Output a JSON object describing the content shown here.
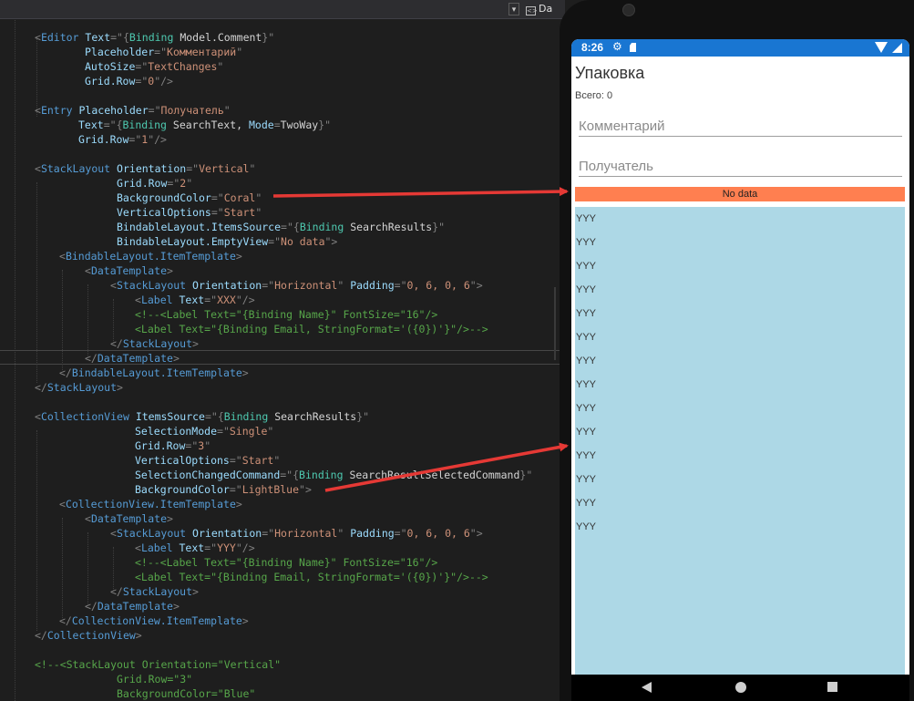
{
  "editor": {
    "tab_label": "Da",
    "dropdown_glyph": "▾",
    "tab_icon_glyph": "<>",
    "lines": [
      {
        "indent": 38,
        "tokens": [
          [
            "t-punc",
            "<"
          ],
          [
            "t-tag",
            "Editor"
          ],
          [
            "t-text",
            " "
          ],
          [
            "t-attr",
            "Text"
          ],
          [
            "t-punc",
            "=\""
          ],
          [
            "t-punc",
            "{"
          ],
          [
            "t-bkw",
            "Binding"
          ],
          [
            "t-text",
            " "
          ],
          [
            "t-bind",
            "Model.Comment"
          ],
          [
            "t-punc",
            "}\""
          ]
        ]
      },
      {
        "indent": 93,
        "tokens": [
          [
            "t-attr",
            "Placeholder"
          ],
          [
            "t-punc",
            "=\""
          ],
          [
            "t-val",
            "Комментарий"
          ],
          [
            "t-punc",
            "\""
          ]
        ]
      },
      {
        "indent": 93,
        "tokens": [
          [
            "t-attr",
            "AutoSize"
          ],
          [
            "t-punc",
            "=\""
          ],
          [
            "t-val",
            "TextChanges"
          ],
          [
            "t-punc",
            "\""
          ]
        ]
      },
      {
        "indent": 93,
        "tokens": [
          [
            "t-attr",
            "Grid.Row"
          ],
          [
            "t-punc",
            "=\""
          ],
          [
            "t-val",
            "0"
          ],
          [
            "t-punc",
            "\"/>"
          ]
        ]
      },
      {
        "indent": 0,
        "tokens": []
      },
      {
        "indent": 38,
        "tokens": [
          [
            "t-punc",
            "<"
          ],
          [
            "t-tag",
            "Entry"
          ],
          [
            "t-text",
            " "
          ],
          [
            "t-attr",
            "Placeholder"
          ],
          [
            "t-punc",
            "=\""
          ],
          [
            "t-val",
            "Получатель"
          ],
          [
            "t-punc",
            "\""
          ]
        ]
      },
      {
        "indent": 86,
        "tokens": [
          [
            "t-attr",
            "Text"
          ],
          [
            "t-punc",
            "=\""
          ],
          [
            "t-punc",
            "{"
          ],
          [
            "t-bkw",
            "Binding"
          ],
          [
            "t-text",
            " "
          ],
          [
            "t-bind",
            "SearchText, "
          ],
          [
            "t-attr",
            "Mode"
          ],
          [
            "t-punc",
            "="
          ],
          [
            "t-bind",
            "TwoWay"
          ],
          [
            "t-punc",
            "}\""
          ]
        ]
      },
      {
        "indent": 86,
        "tokens": [
          [
            "t-attr",
            "Grid.Row"
          ],
          [
            "t-punc",
            "=\""
          ],
          [
            "t-val",
            "1"
          ],
          [
            "t-punc",
            "\"/>"
          ]
        ]
      },
      {
        "indent": 0,
        "tokens": []
      },
      {
        "indent": 38,
        "tokens": [
          [
            "t-punc",
            "<"
          ],
          [
            "t-tag",
            "StackLayout"
          ],
          [
            "t-text",
            " "
          ],
          [
            "t-attr",
            "Orientation"
          ],
          [
            "t-punc",
            "=\""
          ],
          [
            "t-val",
            "Vertical"
          ],
          [
            "t-punc",
            "\""
          ]
        ]
      },
      {
        "indent": 128,
        "tokens": [
          [
            "t-attr",
            "Grid.Row"
          ],
          [
            "t-punc",
            "=\""
          ],
          [
            "t-val",
            "2"
          ],
          [
            "t-punc",
            "\""
          ]
        ]
      },
      {
        "indent": 128,
        "tokens": [
          [
            "t-attr",
            "BackgroundColor"
          ],
          [
            "t-punc",
            "=\""
          ],
          [
            "t-val",
            "Coral"
          ],
          [
            "t-punc",
            "\""
          ]
        ]
      },
      {
        "indent": 128,
        "tokens": [
          [
            "t-attr",
            "VerticalOptions"
          ],
          [
            "t-punc",
            "=\""
          ],
          [
            "t-val",
            "Start"
          ],
          [
            "t-punc",
            "\""
          ]
        ]
      },
      {
        "indent": 128,
        "tokens": [
          [
            "t-attr",
            "BindableLayout.ItemsSource"
          ],
          [
            "t-punc",
            "=\""
          ],
          [
            "t-punc",
            "{"
          ],
          [
            "t-bkw",
            "Binding"
          ],
          [
            "t-text",
            " "
          ],
          [
            "t-bind",
            "SearchResults"
          ],
          [
            "t-punc",
            "}\""
          ]
        ]
      },
      {
        "indent": 128,
        "tokens": [
          [
            "t-attr",
            "BindableLayout.EmptyView"
          ],
          [
            "t-punc",
            "=\""
          ],
          [
            "t-val",
            "No data"
          ],
          [
            "t-punc",
            "\">"
          ]
        ]
      },
      {
        "indent": 65,
        "tokens": [
          [
            "t-punc",
            "<"
          ],
          [
            "t-tag",
            "BindableLayout.ItemTemplate"
          ],
          [
            "t-punc",
            ">"
          ]
        ]
      },
      {
        "indent": 93,
        "tokens": [
          [
            "t-punc",
            "<"
          ],
          [
            "t-tag",
            "DataTemplate"
          ],
          [
            "t-punc",
            ">"
          ]
        ]
      },
      {
        "indent": 121,
        "tokens": [
          [
            "t-punc",
            "<"
          ],
          [
            "t-tag",
            "StackLayout"
          ],
          [
            "t-text",
            " "
          ],
          [
            "t-attr",
            "Orientation"
          ],
          [
            "t-punc",
            "=\""
          ],
          [
            "t-val",
            "Horizontal"
          ],
          [
            "t-punc",
            "\""
          ],
          [
            "t-text",
            " "
          ],
          [
            "t-attr",
            "Padding"
          ],
          [
            "t-punc",
            "=\""
          ],
          [
            "t-val",
            "0, 6, 0, 6"
          ],
          [
            "t-punc",
            "\">"
          ]
        ]
      },
      {
        "indent": 148,
        "tokens": [
          [
            "t-punc",
            "<"
          ],
          [
            "t-tag",
            "Label"
          ],
          [
            "t-text",
            " "
          ],
          [
            "t-attr",
            "Text"
          ],
          [
            "t-punc",
            "=\""
          ],
          [
            "t-val",
            "XXX"
          ],
          [
            "t-punc",
            "\"/>"
          ]
        ]
      },
      {
        "indent": 148,
        "tokens": [
          [
            "t-cmt",
            "<!--<Label Text=\"{Binding Name}\" FontSize=\"16\"/>"
          ]
        ]
      },
      {
        "indent": 148,
        "tokens": [
          [
            "t-cmt",
            "<Label Text=\"{Binding Email, StringFormat='({0})'}\"/>-->"
          ]
        ]
      },
      {
        "indent": 121,
        "tokens": [
          [
            "t-punc",
            "</"
          ],
          [
            "t-tag",
            "StackLayout"
          ],
          [
            "t-punc",
            ">"
          ]
        ]
      },
      {
        "indent": 93,
        "tokens": [
          [
            "t-punc",
            "</"
          ],
          [
            "t-tag",
            "DataTemplate"
          ],
          [
            "t-punc",
            ">"
          ]
        ]
      },
      {
        "indent": 65,
        "tokens": [
          [
            "t-punc",
            "</"
          ],
          [
            "t-tag",
            "BindableLayout.ItemTemplate"
          ],
          [
            "t-punc",
            ">"
          ]
        ]
      },
      {
        "indent": 38,
        "tokens": [
          [
            "t-punc",
            "</"
          ],
          [
            "t-tag",
            "StackLayout"
          ],
          [
            "t-punc",
            ">"
          ]
        ]
      },
      {
        "indent": 0,
        "tokens": []
      },
      {
        "indent": 38,
        "tokens": [
          [
            "t-punc",
            "<"
          ],
          [
            "t-tag",
            "CollectionView"
          ],
          [
            "t-text",
            " "
          ],
          [
            "t-attr",
            "ItemsSource"
          ],
          [
            "t-punc",
            "=\""
          ],
          [
            "t-punc",
            "{"
          ],
          [
            "t-bkw",
            "Binding"
          ],
          [
            "t-text",
            " "
          ],
          [
            "t-bind",
            "SearchResults"
          ],
          [
            "t-punc",
            "}\""
          ]
        ]
      },
      {
        "indent": 148,
        "tokens": [
          [
            "t-attr",
            "SelectionMode"
          ],
          [
            "t-punc",
            "=\""
          ],
          [
            "t-val",
            "Single"
          ],
          [
            "t-punc",
            "\""
          ]
        ]
      },
      {
        "indent": 148,
        "tokens": [
          [
            "t-attr",
            "Grid.Row"
          ],
          [
            "t-punc",
            "=\""
          ],
          [
            "t-val",
            "3"
          ],
          [
            "t-punc",
            "\""
          ]
        ]
      },
      {
        "indent": 148,
        "tokens": [
          [
            "t-attr",
            "VerticalOptions"
          ],
          [
            "t-punc",
            "=\""
          ],
          [
            "t-val",
            "Start"
          ],
          [
            "t-punc",
            "\""
          ]
        ]
      },
      {
        "indent": 148,
        "tokens": [
          [
            "t-attr",
            "SelectionChangedCommand"
          ],
          [
            "t-punc",
            "=\""
          ],
          [
            "t-punc",
            "{"
          ],
          [
            "t-bkw",
            "Binding"
          ],
          [
            "t-text",
            " "
          ],
          [
            "t-bind",
            "SearchResultSelectedCommand"
          ],
          [
            "t-punc",
            "}\""
          ]
        ]
      },
      {
        "indent": 148,
        "tokens": [
          [
            "t-attr",
            "BackgroundColor"
          ],
          [
            "t-punc",
            "=\""
          ],
          [
            "t-val",
            "LightBlue"
          ],
          [
            "t-punc",
            "\">"
          ]
        ]
      },
      {
        "indent": 65,
        "tokens": [
          [
            "t-punc",
            "<"
          ],
          [
            "t-tag",
            "CollectionView.ItemTemplate"
          ],
          [
            "t-punc",
            ">"
          ]
        ]
      },
      {
        "indent": 93,
        "tokens": [
          [
            "t-punc",
            "<"
          ],
          [
            "t-tag",
            "DataTemplate"
          ],
          [
            "t-punc",
            ">"
          ]
        ]
      },
      {
        "indent": 121,
        "tokens": [
          [
            "t-punc",
            "<"
          ],
          [
            "t-tag",
            "StackLayout"
          ],
          [
            "t-text",
            " "
          ],
          [
            "t-attr",
            "Orientation"
          ],
          [
            "t-punc",
            "=\""
          ],
          [
            "t-val",
            "Horizontal"
          ],
          [
            "t-punc",
            "\""
          ],
          [
            "t-text",
            " "
          ],
          [
            "t-attr",
            "Padding"
          ],
          [
            "t-punc",
            "=\""
          ],
          [
            "t-val",
            "0, 6, 0, 6"
          ],
          [
            "t-punc",
            "\">"
          ]
        ]
      },
      {
        "indent": 148,
        "tokens": [
          [
            "t-punc",
            "<"
          ],
          [
            "t-tag",
            "Label"
          ],
          [
            "t-text",
            " "
          ],
          [
            "t-attr",
            "Text"
          ],
          [
            "t-punc",
            "=\""
          ],
          [
            "t-val",
            "YYY"
          ],
          [
            "t-punc",
            "\"/>"
          ]
        ]
      },
      {
        "indent": 148,
        "tokens": [
          [
            "t-cmt",
            "<!--<Label Text=\"{Binding Name}\" FontSize=\"16\"/>"
          ]
        ]
      },
      {
        "indent": 148,
        "tokens": [
          [
            "t-cmt",
            "<Label Text=\"{Binding Email, StringFormat='({0})'}\"/>-->"
          ]
        ]
      },
      {
        "indent": 121,
        "tokens": [
          [
            "t-punc",
            "</"
          ],
          [
            "t-tag",
            "StackLayout"
          ],
          [
            "t-punc",
            ">"
          ]
        ]
      },
      {
        "indent": 93,
        "tokens": [
          [
            "t-punc",
            "</"
          ],
          [
            "t-tag",
            "DataTemplate"
          ],
          [
            "t-punc",
            ">"
          ]
        ]
      },
      {
        "indent": 65,
        "tokens": [
          [
            "t-punc",
            "</"
          ],
          [
            "t-tag",
            "CollectionView.ItemTemplate"
          ],
          [
            "t-punc",
            ">"
          ]
        ]
      },
      {
        "indent": 38,
        "tokens": [
          [
            "t-punc",
            "</"
          ],
          [
            "t-tag",
            "CollectionView"
          ],
          [
            "t-punc",
            ">"
          ]
        ]
      },
      {
        "indent": 0,
        "tokens": []
      },
      {
        "indent": 38,
        "tokens": [
          [
            "t-cmt",
            "<!--<StackLayout Orientation=\"Vertical\""
          ]
        ]
      },
      {
        "indent": 128,
        "tokens": [
          [
            "t-cmt",
            "Grid.Row=\"3\""
          ]
        ]
      },
      {
        "indent": 128,
        "tokens": [
          [
            "t-cmt",
            "BackgroundColor=\"Blue\""
          ]
        ]
      }
    ]
  },
  "phone": {
    "status_bar": {
      "time": "8:26",
      "gear_icon": "gear-icon",
      "sd_icon": "sd-card-icon",
      "wifi_icon": "wifi-icon",
      "signal_icon": "signal-icon",
      "color": "#1976d2"
    },
    "app": {
      "title": "Упаковка",
      "count_label": "Всего: 0",
      "comment_placeholder": "Комментарий",
      "comment_value": "",
      "recipient_placeholder": "Получатель",
      "recipient_value": "",
      "empty_view_text": "No data",
      "empty_view_color": "#ff7f50",
      "collection_color": "#add8e6",
      "collection_items": [
        "YYY",
        "YYY",
        "YYY",
        "YYY",
        "YYY",
        "YYY",
        "YYY",
        "YYY",
        "YYY",
        "YYY",
        "YYY",
        "YYY",
        "YYY",
        "YYY"
      ]
    },
    "nav_bar": {
      "back_icon": "back-triangle-icon",
      "home_icon": "home-circle-icon",
      "recents_icon": "recents-square-icon"
    }
  },
  "annotation": {
    "arrow_color": "#e53935"
  }
}
